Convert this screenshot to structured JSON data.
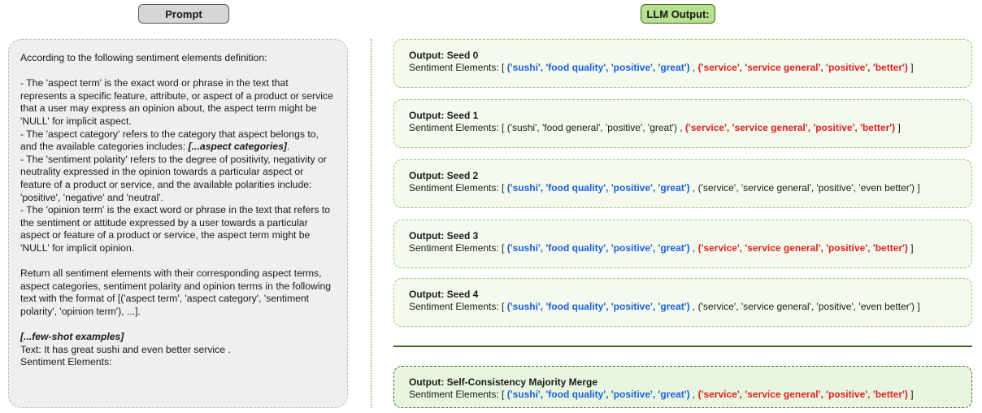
{
  "headers": {
    "prompt": "Prompt",
    "output": "LLM Output:"
  },
  "prompt": {
    "line1": "According to the following sentiment elements definition:",
    "def_aspect_term": "- The 'aspect term' is the exact word or phrase in the text that represents a specific feature, attribute, or aspect of a product or service that a user may express an opinion about, the aspect term might be 'NULL' for implicit aspect.",
    "def_category_prefix": "- The 'aspect category' refers to the category that aspect belongs to, and the available categories includes: ",
    "def_category_placeholder": "[...aspect categories]",
    "def_category_suffix": ".",
    "def_polarity": "- The 'sentiment polarity' refers to the degree of positivity, negativity or neutrality expressed in the opinion towards a particular aspect or feature of a product or service, and the available polarities include: 'positive', 'negative' and 'neutral'.",
    "def_opinion": "- The 'opinion term' is the exact word or phrase in the text that refers to the sentiment or attitude expressed by a user towards a particular aspect or feature of a product or service, the aspect term might be 'NULL' for implicit opinion.",
    "instruction": "Return all sentiment elements with their corresponding aspect terms, aspect categories, sentiment polarity and opinion terms in the following text with the format of [('aspect term', 'aspect category', 'sentiment polarity', 'opinion term'), ...].",
    "few_shot": "[...few-shot examples]",
    "text_line": "Text: It has great sushi and even better service .",
    "elements_line": "Sentiment Elements:"
  },
  "label": "Sentiment Elements: [ ",
  "sep": " , ",
  "close": " ]",
  "seeds": [
    {
      "title": "Output: Seed 0",
      "t1": "('sushi', 'food quality', 'positive', 'great')",
      "t2": "('service', 'service general', 'positive', 'better')"
    },
    {
      "title": "Output: Seed 1",
      "t1": "('sushi', 'food general', 'positive', 'great')",
      "t2": "('service', 'service general', 'positive', 'better')"
    },
    {
      "title": "Output: Seed 2",
      "t1": "('sushi', 'food quality', 'positive', 'great')",
      "t2": "('service', 'service general', 'positive', 'even better')"
    },
    {
      "title": "Output: Seed 3",
      "t1": "('sushi', 'food quality', 'positive', 'great')",
      "t2": "('service', 'service general', 'positive', 'better')"
    },
    {
      "title": "Output: Seed 4",
      "t1": "('sushi', 'food quality', 'positive', 'great')",
      "t2": "('service', 'service general', 'positive', 'even better')"
    }
  ],
  "merge": {
    "title": "Output: Self-Consistency Majority Merge",
    "t1": "('sushi', 'food quality', 'positive', 'great')",
    "t2": "('service', 'service general', 'positive', 'better')"
  },
  "colors": {
    "majority_aspect": "#1a5fe0",
    "majority_service": "#e01f1f"
  }
}
